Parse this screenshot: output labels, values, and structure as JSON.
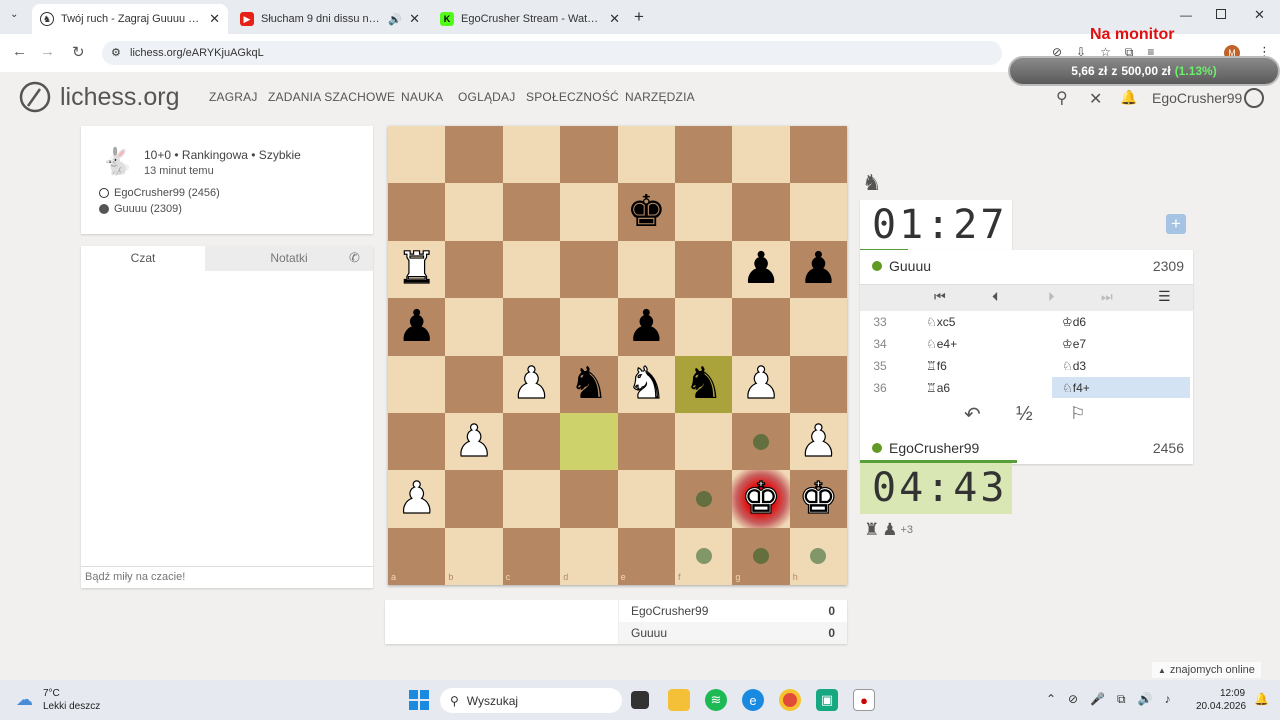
{
  "browser": {
    "tabs": [
      {
        "title": "Twój ruch - Zagraj Guuuu • lich",
        "active": true,
        "icon": "lichess-knight-icon"
      },
      {
        "title": "Słucham 9 dni dissu na rak",
        "active": false,
        "icon": "youtube-icon"
      },
      {
        "title": "EgoCrusher Stream - Watch Liv",
        "active": false,
        "icon": "kick-icon"
      }
    ],
    "url": "lichess.org/eARYKjuAGkqL",
    "donation": {
      "title": "Na monitor",
      "amount": "5,66 zł",
      "sep": "z",
      "goal": "500,00 zł",
      "percent": "(1.13%)"
    }
  },
  "site": {
    "logo": "lichess.org",
    "menu": [
      "ZAGRAJ",
      "ZADANIA SZACHOWE",
      "NAUKA",
      "OGLĄDAJ",
      "SPOŁECZNOŚĆ",
      "NARZĘDZIA"
    ],
    "username": "EgoCrusher99"
  },
  "game": {
    "type": "10+0 • Rankingowa • Szybkie",
    "time_ago": "13 minut temu",
    "white": "EgoCrusher99 (2456)",
    "black": "Guuuu (2309)"
  },
  "chat": {
    "tab_chat": "Czat",
    "tab_notes": "Notatki",
    "placeholder": "Bądź miły na czacie!"
  },
  "board": {
    "files": [
      "a",
      "b",
      "c",
      "d",
      "e",
      "f",
      "g",
      "h"
    ],
    "ranks": [
      "8",
      "7",
      "6",
      "5",
      "4",
      "3",
      "2",
      "1"
    ],
    "pieces": [
      {
        "sq": "e7",
        "p": "♚",
        "c": "b"
      },
      {
        "sq": "a6",
        "p": "♜",
        "c": "w"
      },
      {
        "sq": "g6",
        "p": "♟",
        "c": "b"
      },
      {
        "sq": "h6",
        "p": "♟",
        "c": "b"
      },
      {
        "sq": "a5",
        "p": "♟",
        "c": "b"
      },
      {
        "sq": "e5",
        "p": "♟",
        "c": "b"
      },
      {
        "sq": "c4",
        "p": "♟",
        "c": "w"
      },
      {
        "sq": "d4",
        "p": "♞",
        "c": "b"
      },
      {
        "sq": "e4",
        "p": "♞",
        "c": "w"
      },
      {
        "sq": "f4",
        "p": "♞",
        "c": "b"
      },
      {
        "sq": "g4",
        "p": "♟",
        "c": "w"
      },
      {
        "sq": "b3",
        "p": "♟",
        "c": "w"
      },
      {
        "sq": "h3",
        "p": "♟",
        "c": "w"
      },
      {
        "sq": "a2",
        "p": "♟",
        "c": "w"
      },
      {
        "sq": "g2",
        "p": "♚",
        "c": "w"
      },
      {
        "sq": "h2",
        "p": "♚",
        "c": "w"
      }
    ],
    "last_move": [
      "d3",
      "f4"
    ],
    "check": "g2",
    "dots": [
      "g3",
      "f2",
      "f1",
      "g1",
      "h1"
    ]
  },
  "opponent": {
    "name": "Guuuu",
    "rating": "2309",
    "clock": "01:27"
  },
  "player": {
    "name": "EgoCrusher99",
    "rating": "2456",
    "clock": "04:43",
    "material": "+3"
  },
  "moves": [
    {
      "n": "33",
      "w": "♘xc5",
      "b": "♔d6"
    },
    {
      "n": "34",
      "w": "♘e4+",
      "b": "♔e7"
    },
    {
      "n": "35",
      "w": "♖f6",
      "b": "♘d3"
    },
    {
      "n": "36",
      "w": "♖a6",
      "b": "♘f4+"
    }
  ],
  "controls": {
    "draw": "½"
  },
  "crosstable": {
    "p1": "EgoCrusher99",
    "s1": "0",
    "p2": "Guuuu",
    "s2": "0"
  },
  "friends": "znajomych online",
  "taskbar": {
    "temp": "7°C",
    "weather": "Lekki deszcz",
    "search": "Wyszukaj",
    "time": "12:09",
    "date": "20.04.2026"
  }
}
